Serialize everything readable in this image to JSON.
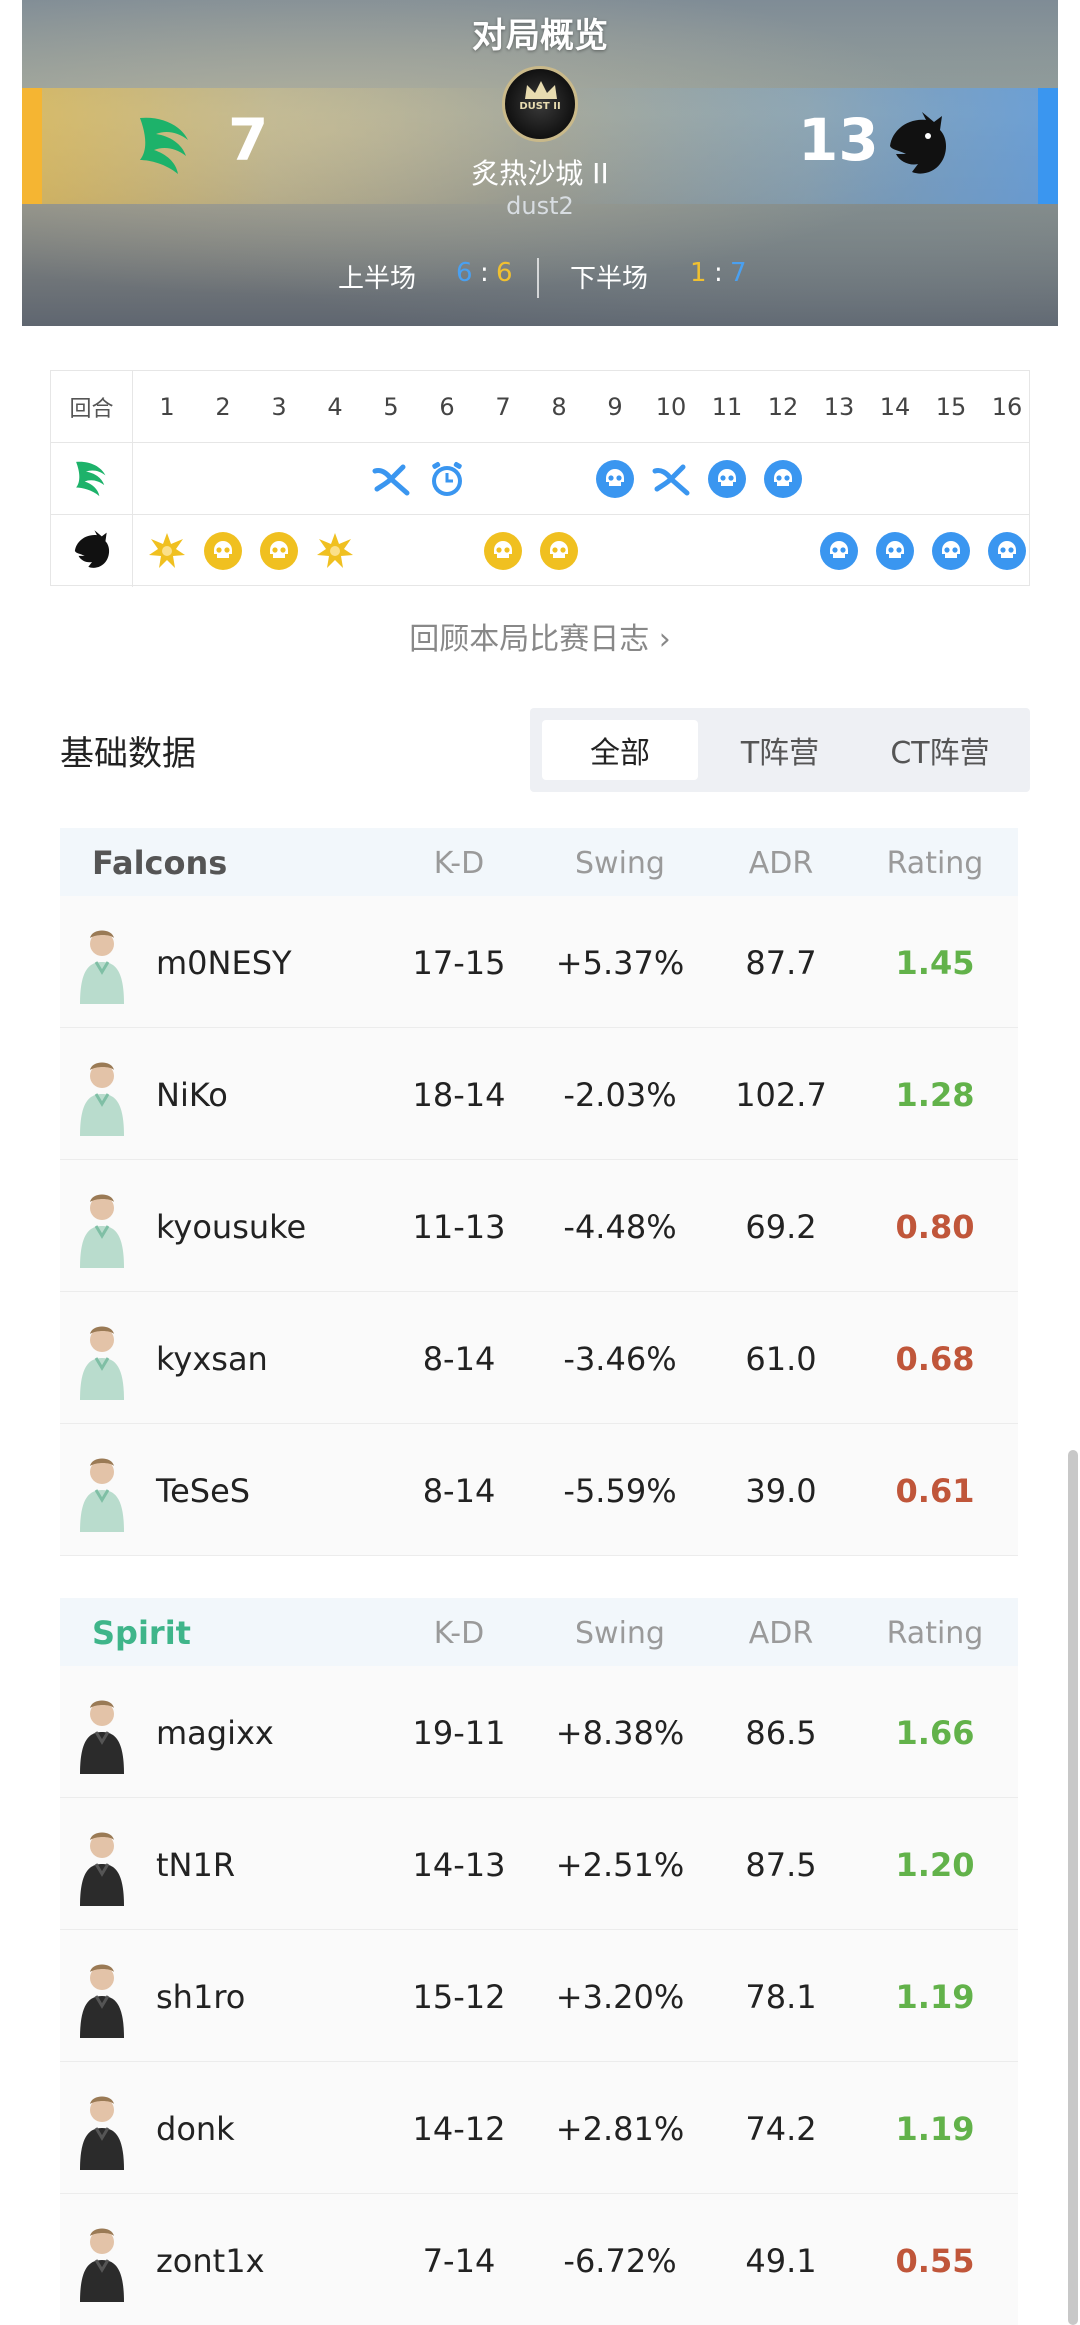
{
  "header": {
    "title": "对局概览",
    "left_score": "7",
    "right_score": "13",
    "map_name": "炙热沙城 II",
    "map_code": "dust2",
    "map_badge": "DUST II",
    "first_half_label": "上半场",
    "first_half_left": "6",
    "first_half_sep": ":",
    "first_half_right": "6",
    "second_half_label": "下半场",
    "second_half_left": "1",
    "second_half_sep": ":",
    "second_half_right": "7",
    "colors": {
      "t_side": "#f5b532",
      "ct_side": "#3a96f0"
    }
  },
  "rounds": {
    "head_label": "回合",
    "numbers": [
      "1",
      "2",
      "3",
      "4",
      "5",
      "6",
      "7",
      "8",
      "9",
      "10",
      "11",
      "12",
      "13",
      "14",
      "15",
      "16"
    ],
    "team1_icons": [
      "",
      "",
      "",
      "",
      "defuse-icon",
      "time-icon",
      "",
      "",
      "skull-icon",
      "defuse-icon",
      "skull-icon",
      "skull-icon",
      "",
      "",
      "",
      ""
    ],
    "team2_icons": [
      "explosion-icon",
      "skull-icon",
      "skull-icon",
      "explosion-icon",
      "",
      "",
      "skull-icon",
      "skull-icon",
      "",
      "",
      "",
      "",
      "skull-icon",
      "skull-icon",
      "skull-icon",
      "skull-icon"
    ],
    "team2_icon_colors": [
      "gold",
      "gold",
      "gold",
      "gold",
      "",
      "",
      "gold",
      "gold",
      "",
      "",
      "",
      "",
      "blue",
      "blue",
      "blue",
      "blue"
    ]
  },
  "review_link": "回顾本局比赛日志 ›",
  "stats": {
    "title": "基础数据",
    "tabs": [
      "全部",
      "T阵营",
      "CT阵营"
    ],
    "columns": [
      "K-D",
      "Swing",
      "ADR",
      "Rating"
    ],
    "team1": {
      "name": "Falcons",
      "players": [
        {
          "name": "m0NESY",
          "kd": "17-15",
          "swing": "+5.37%",
          "adr": "87.7",
          "rating": "1.45",
          "good": true
        },
        {
          "name": "NiKo",
          "kd": "18-14",
          "swing": "-2.03%",
          "adr": "102.7",
          "rating": "1.28",
          "good": true
        },
        {
          "name": "kyousuke",
          "kd": "11-13",
          "swing": "-4.48%",
          "adr": "69.2",
          "rating": "0.80",
          "good": false
        },
        {
          "name": "kyxsan",
          "kd": "8-14",
          "swing": "-3.46%",
          "adr": "61.0",
          "rating": "0.68",
          "good": false
        },
        {
          "name": "TeSeS",
          "kd": "8-14",
          "swing": "-5.59%",
          "adr": "39.0",
          "rating": "0.61",
          "good": false
        }
      ]
    },
    "team2": {
      "name": "Spirit",
      "players": [
        {
          "name": "magixx",
          "kd": "19-11",
          "swing": "+8.38%",
          "adr": "86.5",
          "rating": "1.66",
          "good": true
        },
        {
          "name": "tN1R",
          "kd": "14-13",
          "swing": "+2.51%",
          "adr": "87.5",
          "rating": "1.20",
          "good": true
        },
        {
          "name": "sh1ro",
          "kd": "15-12",
          "swing": "+3.20%",
          "adr": "78.1",
          "rating": "1.19",
          "good": true
        },
        {
          "name": "donk",
          "kd": "14-12",
          "swing": "+2.81%",
          "adr": "74.2",
          "rating": "1.19",
          "good": true
        },
        {
          "name": "zont1x",
          "kd": "7-14",
          "swing": "-6.72%",
          "adr": "49.1",
          "rating": "0.55",
          "good": false
        }
      ]
    }
  }
}
